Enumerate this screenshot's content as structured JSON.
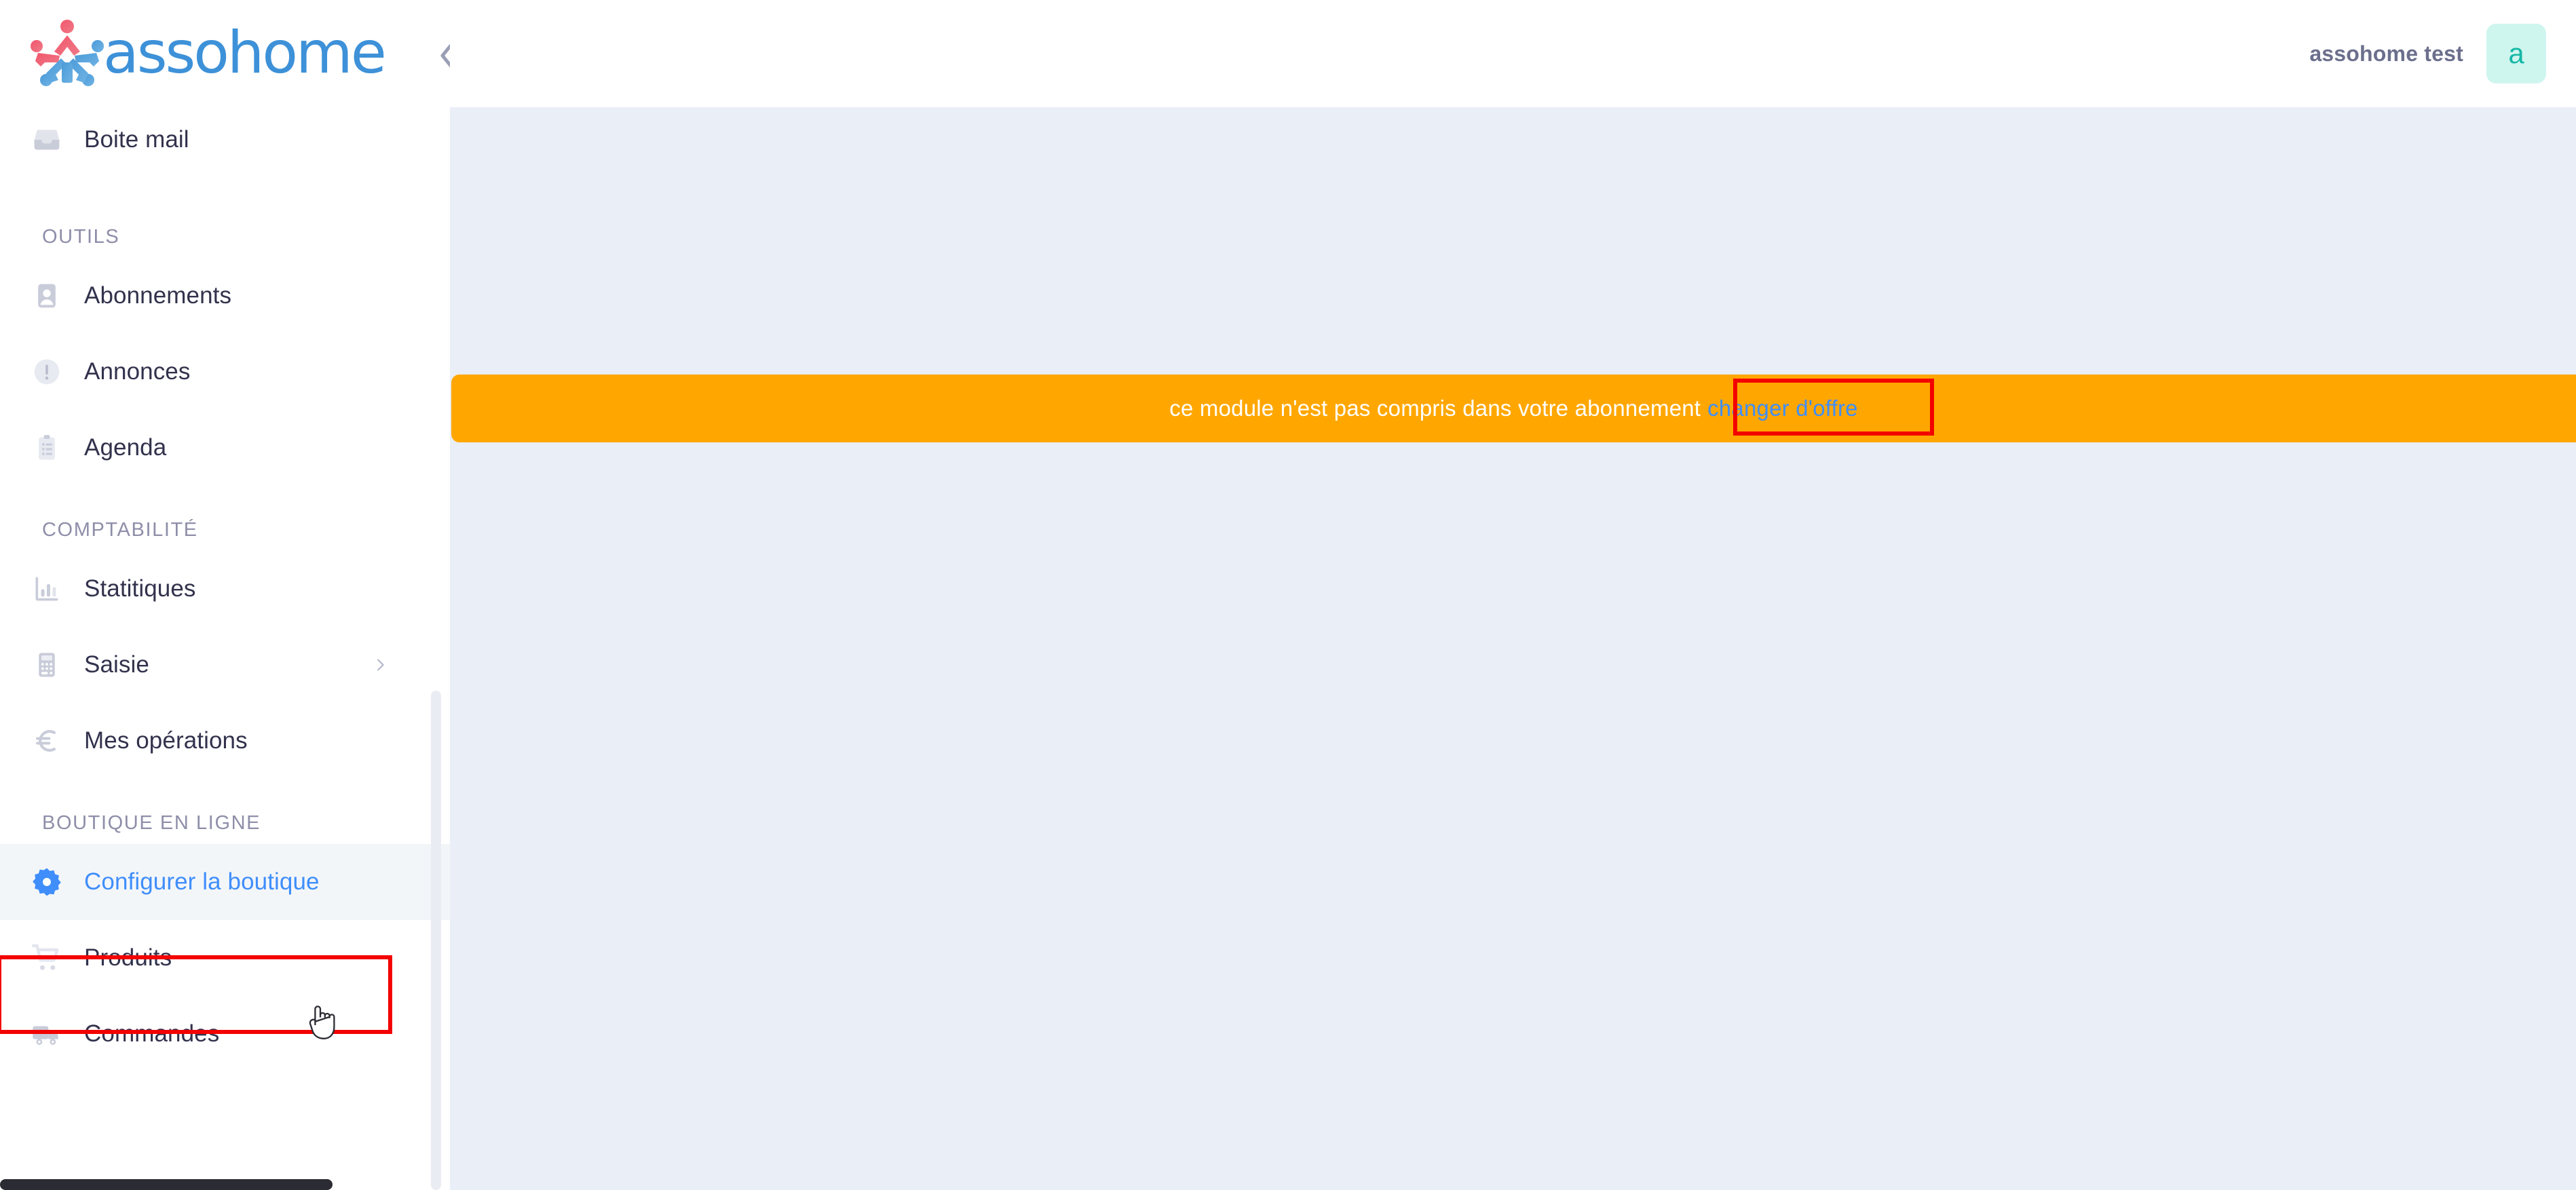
{
  "brand": {
    "name": "assohome",
    "logo_icon": "assohome-people-logo",
    "word_color": "#3d91d8"
  },
  "header": {
    "collapse_icon": "double-chevron-left-icon",
    "user_name": "assohome test",
    "avatar_initial": "a",
    "avatar_bg": "#cff5ef",
    "avatar_color": "#14b8a6"
  },
  "sidebar": {
    "top_items": [
      {
        "label": "Boite mail",
        "icon": "inbox-icon",
        "name": "sidebar-item-boite-mail"
      }
    ],
    "sections": [
      {
        "title": "OUTILS",
        "name": "sidebar-section-outils",
        "items": [
          {
            "label": "Abonnements",
            "icon": "contact-card-icon",
            "name": "sidebar-item-abonnements",
            "caret": false
          },
          {
            "label": "Annonces",
            "icon": "alert-circle-icon",
            "name": "sidebar-item-annonces",
            "caret": false
          },
          {
            "label": "Agenda",
            "icon": "clipboard-icon",
            "name": "sidebar-item-agenda",
            "caret": false
          }
        ]
      },
      {
        "title": "COMPTABILITÉ",
        "name": "sidebar-section-comptabilite",
        "items": [
          {
            "label": "Statitiques",
            "icon": "bar-chart-icon",
            "name": "sidebar-item-statitiques",
            "caret": false
          },
          {
            "label": "Saisie",
            "icon": "calculator-icon",
            "name": "sidebar-item-saisie",
            "caret": true
          },
          {
            "label": "Mes opérations",
            "icon": "euro-icon",
            "name": "sidebar-item-mes-operations",
            "caret": false
          }
        ]
      },
      {
        "title": "BOUTIQUE EN LIGNE",
        "name": "sidebar-section-boutique-en-ligne",
        "items": [
          {
            "label": "Configurer la boutique",
            "icon": "gear-icon",
            "name": "sidebar-item-configurer-la-boutique",
            "caret": false,
            "active": true
          },
          {
            "label": "Produits",
            "icon": "shopping-cart-icon",
            "name": "sidebar-item-produits",
            "caret": false
          },
          {
            "label": "Commandes",
            "icon": "delivery-truck-icon",
            "name": "sidebar-item-commandes",
            "caret": false
          }
        ]
      }
    ]
  },
  "main": {
    "banner": {
      "message": "ce module n'est pas compris dans votre abonnement",
      "cta_label": "changer d'offre",
      "bg_color": "#ffa700",
      "text_color": "#ffffff",
      "cta_color": "#3f8efc"
    },
    "background_color": "#eaeef7"
  },
  "annotations": {
    "highlight_color": "#f30000",
    "boxes": [
      {
        "name": "annotation-box-configurer-la-boutique"
      },
      {
        "name": "annotation-box-changer-doffre"
      }
    ]
  }
}
